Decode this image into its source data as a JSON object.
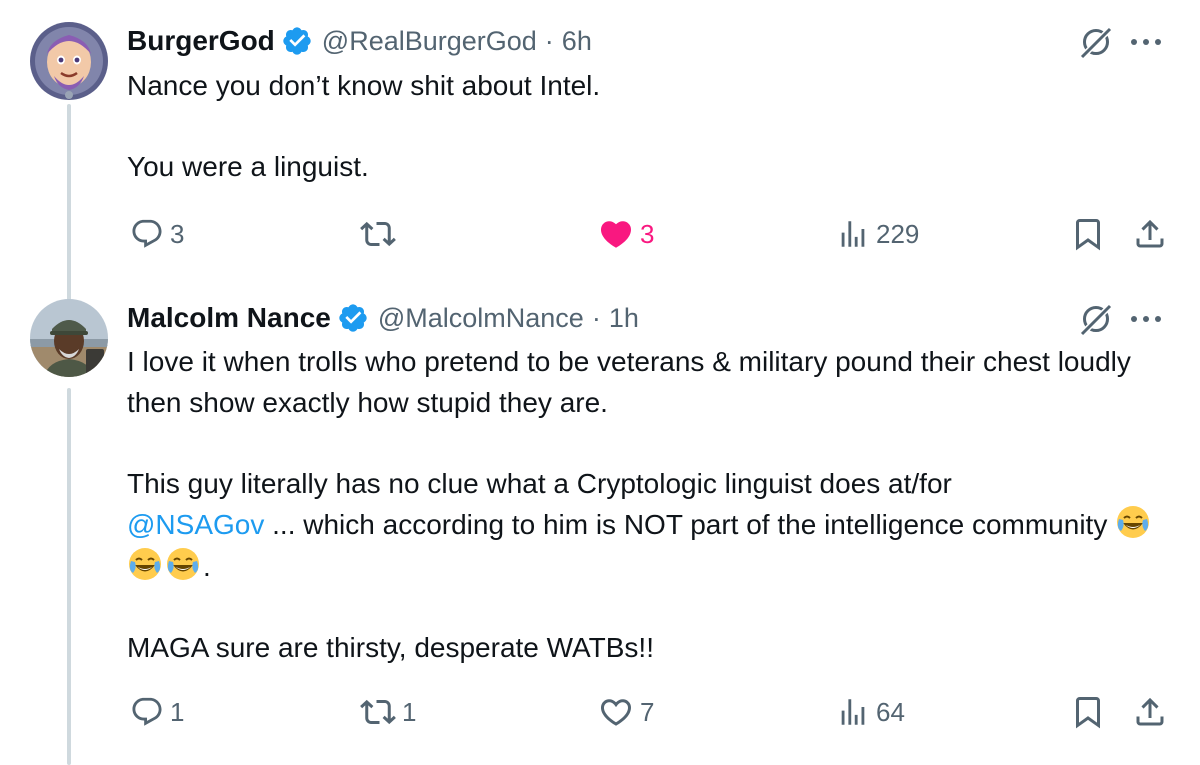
{
  "tweets": [
    {
      "author": "BurgerGod",
      "handle": "@RealBurgerGod",
      "separator": "·",
      "time": "6h",
      "verified": true,
      "avatar": "buzz-lightyear-avatar",
      "paragraphs": [
        "Nance you don’t know shit about Intel.",
        "You were a linguist."
      ],
      "actions": {
        "replies": "3",
        "reposts": "",
        "likes": "3",
        "liked": true,
        "views": "229"
      }
    },
    {
      "author": "Malcolm Nance",
      "handle": "@MalcolmNance",
      "separator": "·",
      "time": "1h",
      "verified": true,
      "avatar": "man-in-cap-avatar",
      "paragraphs": [
        "I love it when trolls who pretend to be veterans & military pound their chest loudly then show exactly how stupid they are.",
        "This guy literally has no clue what a Cryptologic linguist does at/for",
        "@NSAGov",
        " ... which according to him is NOT part of the intelligence community",
        ".",
        "MAGA sure are thirsty, desperate WATBs!!"
      ],
      "emojis": [
        "face-with-tears-of-joy",
        "face-with-tears-of-joy",
        "face-with-tears-of-joy"
      ],
      "actions": {
        "replies": "1",
        "reposts": "1",
        "likes": "7",
        "liked": false,
        "views": "64"
      }
    }
  ],
  "icons": {
    "verified": "verified-badge-icon",
    "grok": "grok-icon",
    "more": "more-icon",
    "reply": "reply-icon",
    "repost": "repost-icon",
    "like": "heart-icon",
    "views": "views-icon",
    "bookmark": "bookmark-icon",
    "share": "share-icon",
    "emoji": "face-with-tears-of-joy-emoji"
  },
  "colors": {
    "text": "#0f1419",
    "secondary": "#536471",
    "link": "#1d9bf0",
    "verified": "#1d9bf0",
    "like": "#f91880",
    "thread_line": "#cfd9de",
    "background": "#ffffff"
  }
}
